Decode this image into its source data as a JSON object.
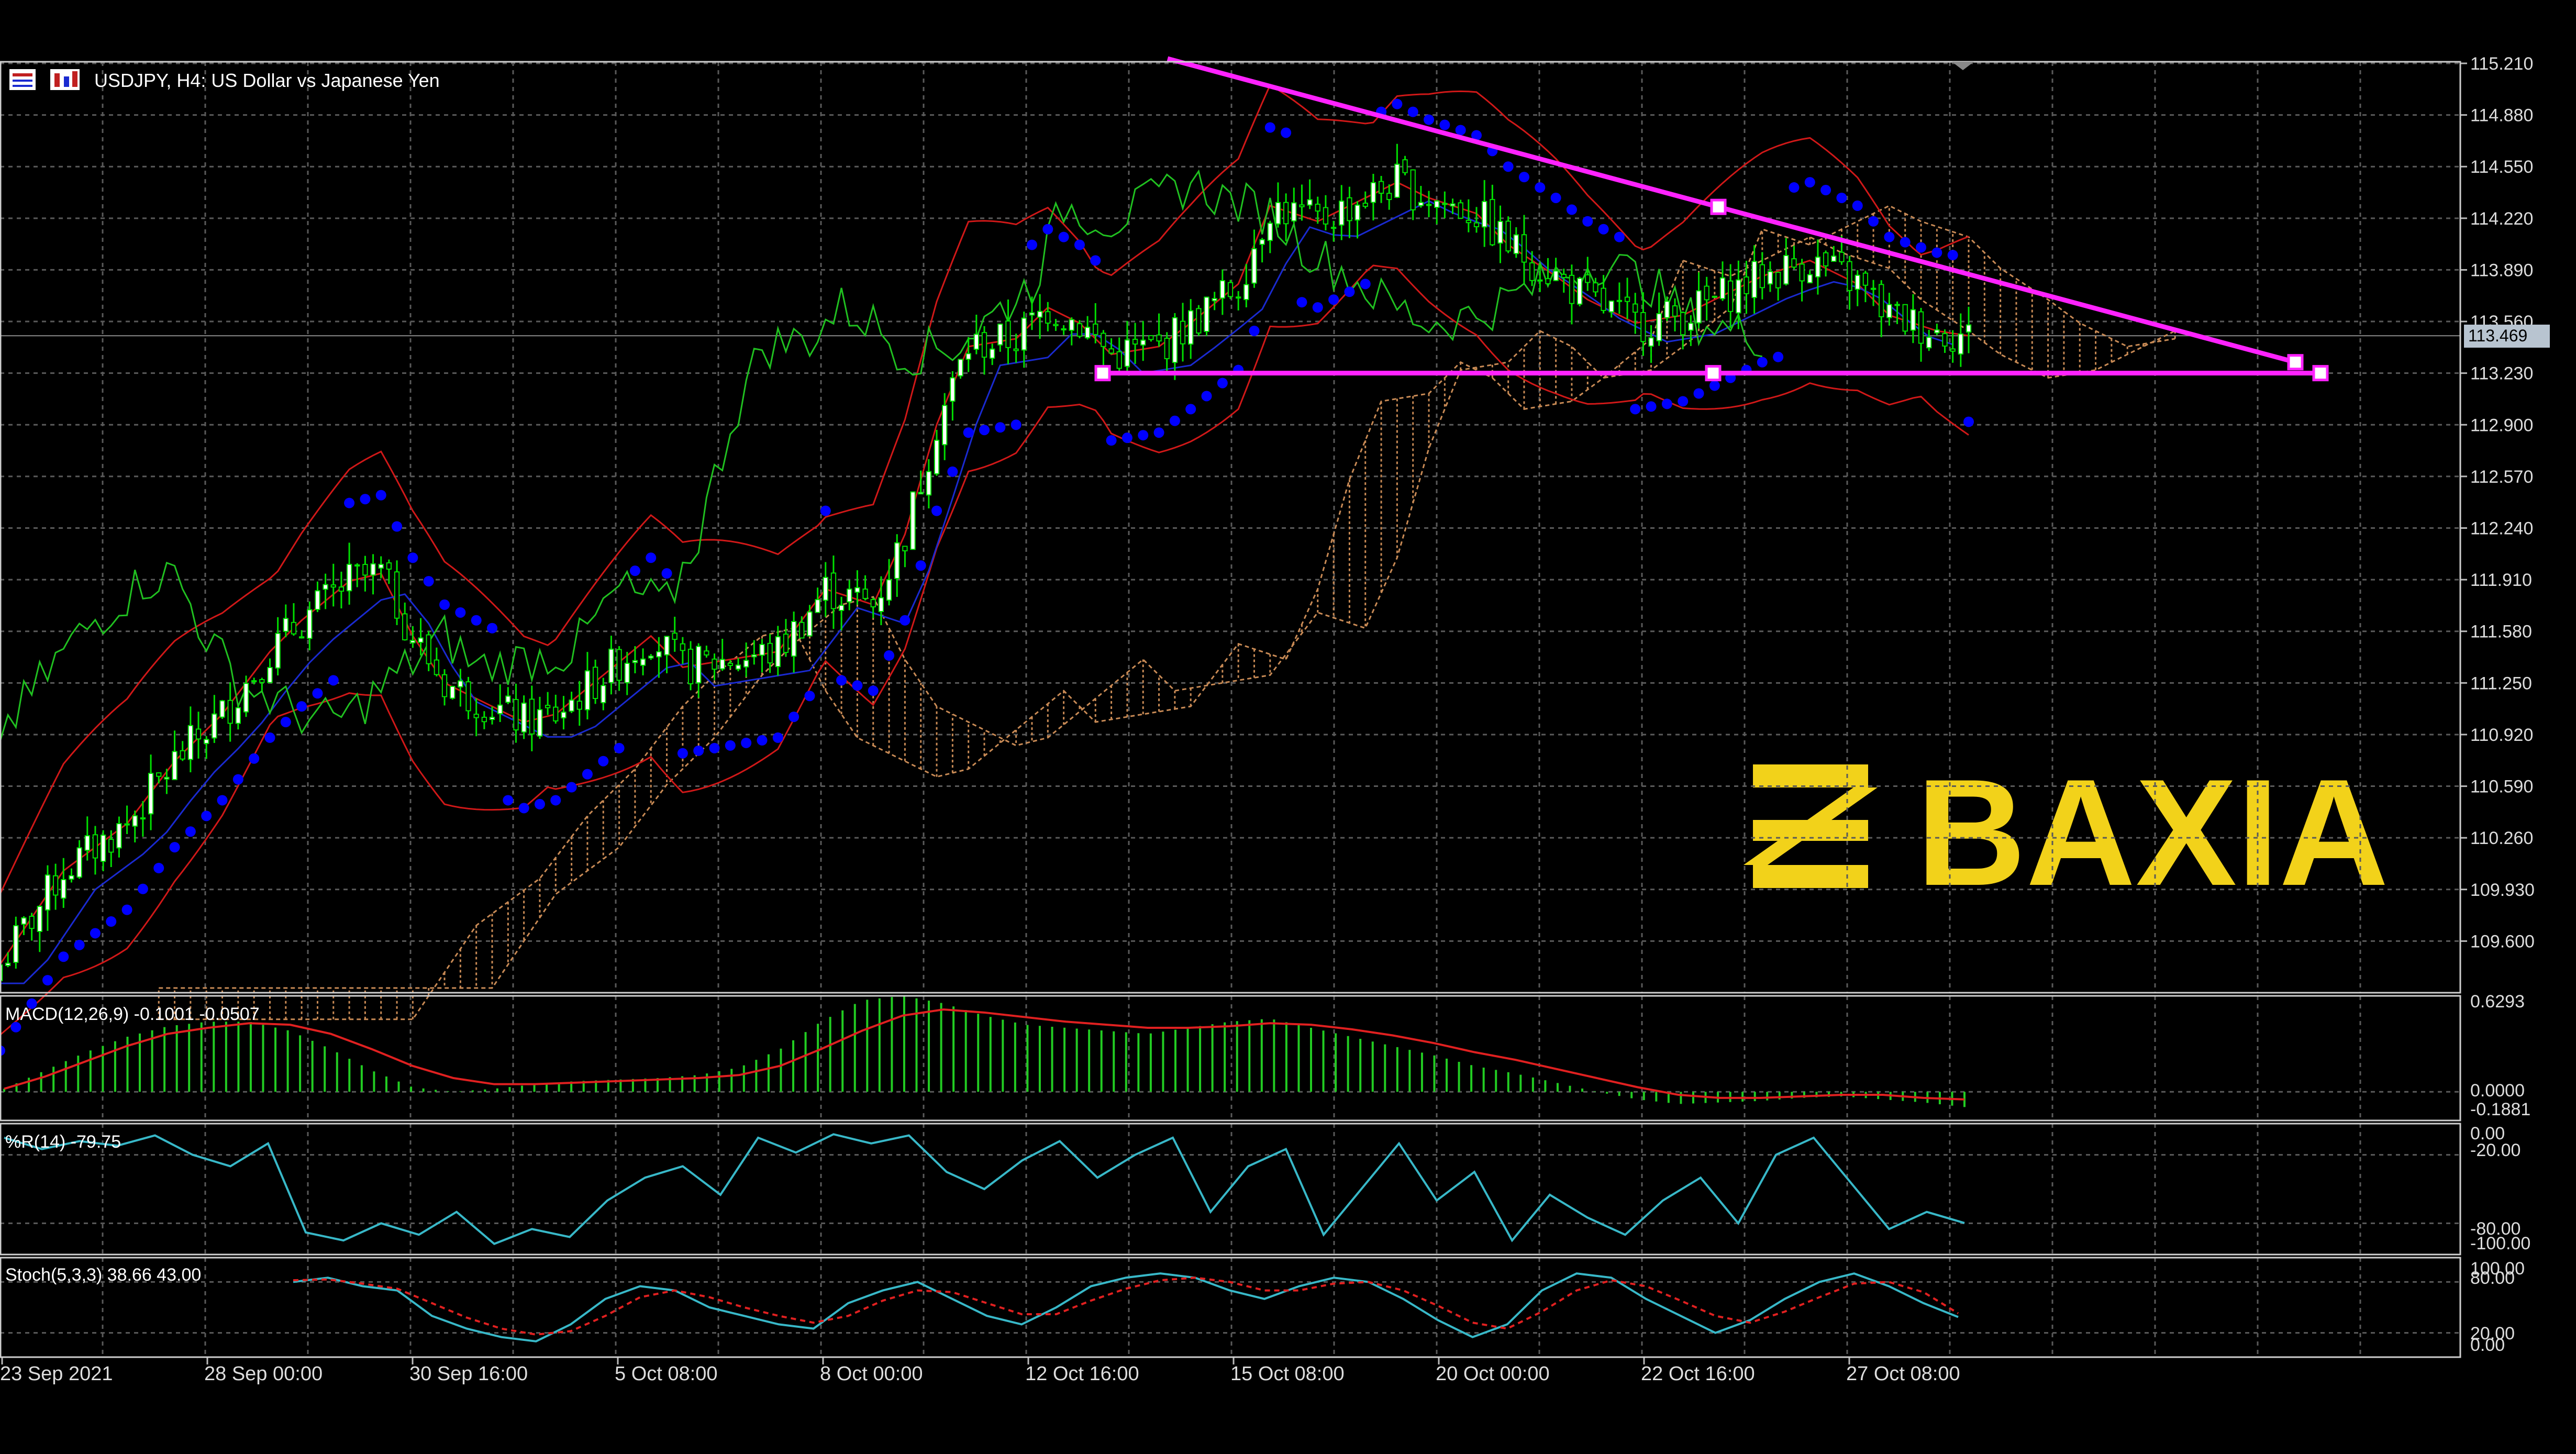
{
  "window": {
    "symbol_title": "USDJPY, H4:  US Dollar vs Japanese Yen",
    "current_price": "113.469"
  },
  "logo": {
    "text": "BAXIA",
    "color": "#F2D21A"
  },
  "colors": {
    "background": "#000000",
    "grid": "#5a5a5a",
    "bull_candle": "#ffffff",
    "bear_candle": "#ffffff",
    "wick": "#00e000",
    "bollinger": "#d01818",
    "tenkan": "#1a2ad0",
    "chikou": "#20c020",
    "sar": "#0000ff",
    "cloud": "#c88a55",
    "trendline": "#ff22ff",
    "macd_hist": "#22cc22",
    "macd_signal": "#e02020",
    "wpr": "#38b8c8",
    "stoch_main": "#38b8c8",
    "stoch_signal": "#e02020"
  },
  "chart_data": [
    {
      "type": "candlestick",
      "title": "USDJPY, H4:  US Dollar vs Japanese Yen",
      "ylim": [
        109.27,
        115.22
      ],
      "yticks": [
        "115.210",
        "114.880",
        "114.550",
        "114.220",
        "113.890",
        "113.560",
        "113.230",
        "112.900",
        "112.570",
        "112.240",
        "111.910",
        "111.580",
        "111.250",
        "110.920",
        "110.590",
        "110.260",
        "109.930",
        "109.600"
      ],
      "xticks": [
        "23 Sep 2021",
        "28 Sep 00:00",
        "30 Sep 16:00",
        "5 Oct 08:00",
        "8 Oct 00:00",
        "12 Oct 16:00",
        "15 Oct 08:00",
        "20 Oct 00:00",
        "22 Oct 16:00",
        "27 Oct 08:00"
      ],
      "last_close": 113.469,
      "support_level": 113.23,
      "resistance_line": {
        "from": 115.24,
        "to": 113.3,
        "description": "descending trendline"
      },
      "close_path": [
        {
          "x": 0,
          "y": 109.45
        },
        {
          "x": 8,
          "y": 110.05
        },
        {
          "x": 16,
          "y": 110.35
        },
        {
          "x": 22,
          "y": 110.75
        },
        {
          "x": 28,
          "y": 111.05
        },
        {
          "x": 34,
          "y": 111.45
        },
        {
          "x": 38,
          "y": 111.65
        },
        {
          "x": 44,
          "y": 111.9
        },
        {
          "x": 48,
          "y": 111.95
        },
        {
          "x": 52,
          "y": 111.55
        },
        {
          "x": 56,
          "y": 111.25
        },
        {
          "x": 60,
          "y": 111.15
        },
        {
          "x": 66,
          "y": 111.0
        },
        {
          "x": 70,
          "y": 111.05
        },
        {
          "x": 76,
          "y": 111.3
        },
        {
          "x": 82,
          "y": 111.55
        },
        {
          "x": 86,
          "y": 111.35
        },
        {
          "x": 92,
          "y": 111.4
        },
        {
          "x": 98,
          "y": 111.45
        },
        {
          "x": 104,
          "y": 111.85
        },
        {
          "x": 110,
          "y": 111.75
        },
        {
          "x": 114,
          "y": 112.2
        },
        {
          "x": 118,
          "y": 112.9
        },
        {
          "x": 122,
          "y": 113.4
        },
        {
          "x": 128,
          "y": 113.45
        },
        {
          "x": 132,
          "y": 113.65
        },
        {
          "x": 136,
          "y": 113.55
        },
        {
          "x": 140,
          "y": 113.35
        },
        {
          "x": 146,
          "y": 113.4
        },
        {
          "x": 150,
          "y": 113.55
        },
        {
          "x": 156,
          "y": 113.8
        },
        {
          "x": 160,
          "y": 114.3
        },
        {
          "x": 166,
          "y": 114.2
        },
        {
          "x": 172,
          "y": 114.35
        },
        {
          "x": 176,
          "y": 114.45
        },
        {
          "x": 180,
          "y": 114.35
        },
        {
          "x": 186,
          "y": 114.25
        },
        {
          "x": 190,
          "y": 114.05
        },
        {
          "x": 196,
          "y": 113.85
        },
        {
          "x": 200,
          "y": 113.7
        },
        {
          "x": 206,
          "y": 113.55
        },
        {
          "x": 212,
          "y": 113.6
        },
        {
          "x": 218,
          "y": 113.75
        },
        {
          "x": 222,
          "y": 113.85
        },
        {
          "x": 228,
          "y": 113.95
        },
        {
          "x": 234,
          "y": 113.8
        },
        {
          "x": 238,
          "y": 113.6
        },
        {
          "x": 244,
          "y": 113.5
        },
        {
          "x": 248,
          "y": 113.469
        }
      ],
      "series": [
        {
          "name": "Bollinger Bands",
          "values": []
        },
        {
          "name": "Ichimoku Kinko Hyo",
          "values": []
        },
        {
          "name": "Parabolic SAR",
          "values": []
        }
      ]
    },
    {
      "type": "bar",
      "title": "MACD(12,26,9) -0.1001 -0.0507",
      "ylim": [
        -0.1881,
        0.6293
      ],
      "yticks": [
        "0.6293",
        "0.0000",
        "-0.1881"
      ],
      "values": [
        0.02,
        0.14,
        0.26,
        0.36,
        0.43,
        0.46,
        0.46,
        0.4,
        0.28,
        0.14,
        0.03,
        0.0,
        0.02,
        0.05,
        0.07,
        0.08,
        0.09,
        0.11,
        0.16,
        0.28,
        0.46,
        0.6,
        0.63,
        0.58,
        0.5,
        0.44,
        0.42,
        0.4,
        0.38,
        0.42,
        0.46,
        0.48,
        0.42,
        0.36,
        0.3,
        0.24,
        0.17,
        0.12,
        0.06,
        0.0,
        -0.05,
        -0.08,
        -0.07,
        -0.06,
        -0.04,
        -0.03,
        -0.05,
        -0.07,
        -0.1
      ],
      "signal": [
        0.02,
        0.1,
        0.2,
        0.3,
        0.38,
        0.42,
        0.45,
        0.44,
        0.38,
        0.28,
        0.17,
        0.09,
        0.05,
        0.05,
        0.06,
        0.07,
        0.08,
        0.09,
        0.11,
        0.17,
        0.28,
        0.4,
        0.5,
        0.54,
        0.52,
        0.49,
        0.46,
        0.44,
        0.42,
        0.42,
        0.43,
        0.45,
        0.44,
        0.41,
        0.37,
        0.32,
        0.26,
        0.21,
        0.15,
        0.09,
        0.03,
        -0.02,
        -0.04,
        -0.04,
        -0.03,
        -0.02,
        -0.02,
        -0.04,
        -0.05
      ]
    },
    {
      "type": "line",
      "title": "%R(14) -79.75",
      "ylim": [
        -100,
        0
      ],
      "yticks": [
        "0.00",
        "-20.00",
        "-80.00",
        "-100.00"
      ],
      "values": [
        -5,
        -15,
        -8,
        -12,
        -3,
        -20,
        -30,
        -10,
        -88,
        -95,
        -80,
        -90,
        -70,
        -98,
        -85,
        -92,
        -60,
        -40,
        -30,
        -55,
        -5,
        -18,
        -2,
        -10,
        -3,
        -35,
        -50,
        -25,
        -8,
        -40,
        -20,
        -5,
        -70,
        -30,
        -15,
        -90,
        -50,
        -10,
        -60,
        -35,
        -95,
        -55,
        -75,
        -90,
        -60,
        -40,
        -80,
        -20,
        -5,
        -45,
        -85,
        -70,
        -79.75
      ],
      "xlabel": "",
      "ylabel": ""
    },
    {
      "type": "line",
      "title": "Stoch(5,3,3) 38.66 43.00",
      "ylim": [
        0,
        100
      ],
      "yticks": [
        "100.00",
        "80.00",
        "20.00",
        "0.00"
      ],
      "series": [
        {
          "values": [
            80,
            85,
            75,
            70,
            40,
            25,
            15,
            10,
            30,
            60,
            75,
            70,
            50,
            40,
            30,
            25,
            55,
            70,
            80,
            60,
            40,
            30,
            50,
            75,
            85,
            90,
            85,
            70,
            60,
            75,
            85,
            80,
            60,
            35,
            15,
            30,
            70,
            90,
            85,
            60,
            40,
            20,
            35,
            60,
            80,
            90,
            75,
            55,
            38.66
          ]
        },
        {
          "values": [
            82,
            83,
            78,
            72,
            55,
            38,
            25,
            18,
            22,
            40,
            62,
            70,
            62,
            50,
            40,
            32,
            40,
            58,
            70,
            68,
            55,
            42,
            42,
            58,
            72,
            82,
            85,
            80,
            70,
            70,
            78,
            80,
            70,
            52,
            32,
            25,
            45,
            70,
            82,
            75,
            58,
            40,
            32,
            45,
            62,
            78,
            80,
            68,
            43.0
          ]
        }
      ]
    }
  ]
}
